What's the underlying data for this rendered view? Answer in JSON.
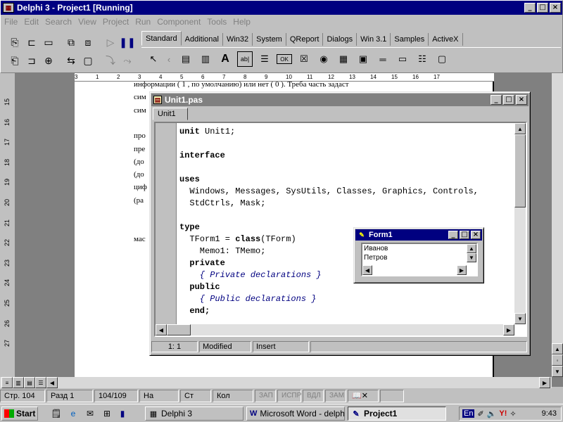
{
  "delphi": {
    "title": "Delphi 3 - Project1 [Running]",
    "menu": [
      "File",
      "Edit",
      "Search",
      "View",
      "Project",
      "Run",
      "Component",
      "Tools",
      "Help"
    ],
    "palette_tabs": [
      "Standard",
      "Additional",
      "Win32",
      "System",
      "QReport",
      "Dialogs",
      "Win 3.1",
      "Samples",
      "ActiveX"
    ],
    "active_palette_tab": "Standard",
    "palette_glyphs": {
      "label": "A",
      "edit": "ab|",
      "button": "OK"
    }
  },
  "window_buttons": {
    "minimize": "_",
    "maximize": "□",
    "close": "×"
  },
  "word_doc": {
    "ruler_numbers": [
      "3",
      "1",
      "2",
      "3",
      "4",
      "5",
      "6",
      "7",
      "8",
      "9",
      "10",
      "11",
      "12",
      "13",
      "14",
      "15",
      "16",
      "17"
    ],
    "vruler_numbers": [
      "15",
      "16",
      "17",
      "18",
      "19",
      "20",
      "21",
      "22",
      "23",
      "24",
      "25",
      "26",
      "27"
    ],
    "lines": [
      "информации ( 1 , по умолчанию) или нет ( 0 ). Треба   часть задаст",
      "сим",
      "сим",
      "",
      "про",
      "пре",
      "(до",
      "(до",
      "циф",
      "(ра",
      "",
      "",
      "мас"
    ]
  },
  "word_status": {
    "page": "Стр. 104",
    "section": "Разд 1",
    "pages": "104/109",
    "at": "На",
    "line": "Ст",
    "col": "Кол",
    "rec": "ЗАП",
    "trk": "ИСПР",
    "ext": "ВДЛ",
    "ovr": "ЗАМ"
  },
  "editor": {
    "title": "Unit1.pas",
    "tab": "Unit1",
    "status_pos": "1:   1",
    "status_modified": "Modified",
    "status_mode": "Insert",
    "code": [
      [
        {
          "t": "unit",
          "k": "kw"
        },
        {
          "t": " Unit1;",
          "k": ""
        }
      ],
      [],
      [
        {
          "t": "interface",
          "k": "kw"
        }
      ],
      [],
      [
        {
          "t": "uses",
          "k": "kw"
        }
      ],
      [
        {
          "t": "  Windows, Messages, SysUtils, Classes, Graphics, Controls,",
          "k": ""
        }
      ],
      [
        {
          "t": "  StdCtrls, Mask;",
          "k": ""
        }
      ],
      [],
      [
        {
          "t": "type",
          "k": "kw"
        }
      ],
      [
        {
          "t": "  TForm1 = ",
          "k": ""
        },
        {
          "t": "class",
          "k": "kw"
        },
        {
          "t": "(TForm)",
          "k": ""
        }
      ],
      [
        {
          "t": "    Memo1: TMemo;",
          "k": ""
        }
      ],
      [
        {
          "t": "  private",
          "k": "kw"
        }
      ],
      [
        {
          "t": "    { Private declarations }",
          "k": "cm"
        }
      ],
      [
        {
          "t": "  public",
          "k": "kw"
        }
      ],
      [
        {
          "t": "    { Public declarations }",
          "k": "cm"
        }
      ],
      [
        {
          "t": "  end;",
          "k": "kw"
        }
      ]
    ]
  },
  "form1": {
    "title": "Form1",
    "memo_lines": [
      "Иванов",
      "Петров"
    ]
  },
  "taskbar": {
    "start": "Start",
    "tasks": [
      {
        "label": "Delphi 3",
        "active": false
      },
      {
        "label": "Microsoft Word - delphi",
        "active": false
      },
      {
        "label": "Project1",
        "active": true
      }
    ],
    "lang": "En",
    "clock": "9:43"
  }
}
